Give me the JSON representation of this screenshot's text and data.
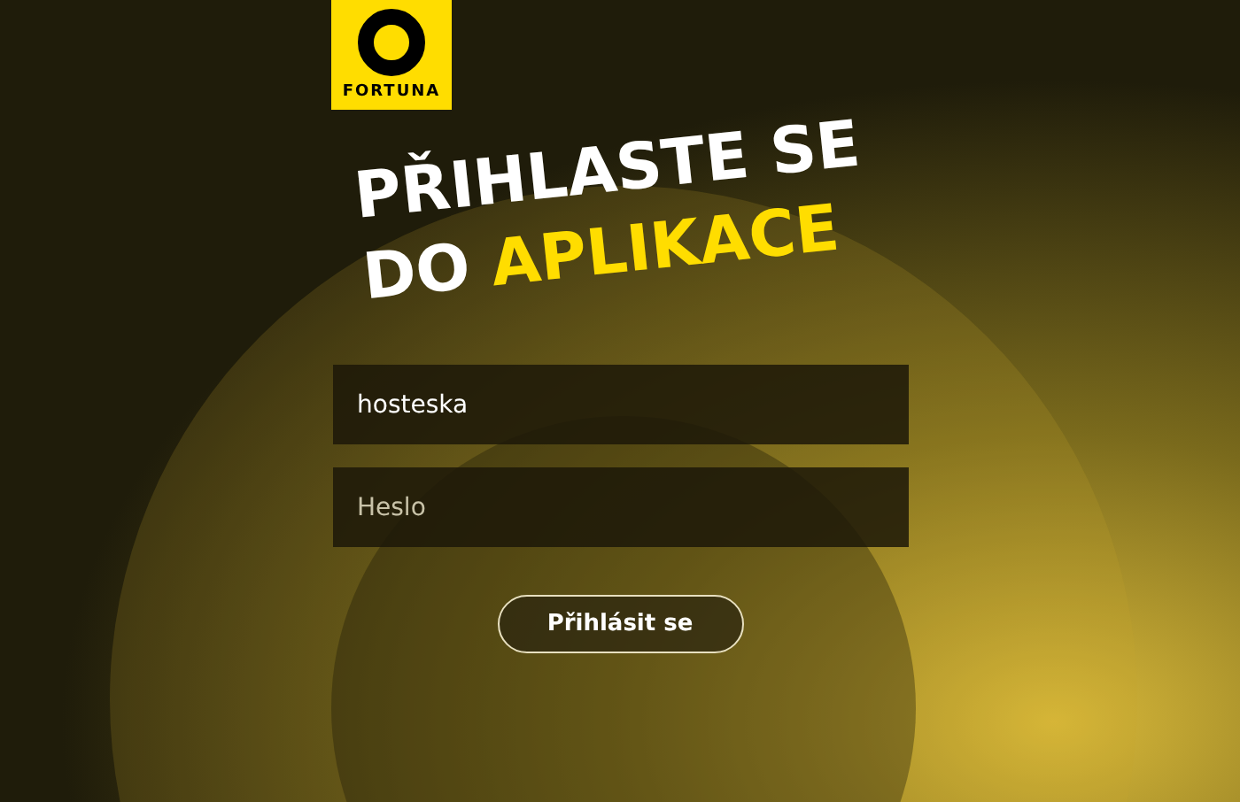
{
  "logo": {
    "text": "FORTUNA"
  },
  "heading": {
    "line_1": [
      {
        "text": "PŘIHLASTE SE",
        "highlighted": false
      }
    ],
    "line_2": [
      {
        "text": "DO",
        "highlighted": false
      },
      {
        "text": "APLIKACE",
        "highlighted": true
      }
    ]
  },
  "username_field": {
    "value": "hosteska"
  },
  "password_field": {
    "placeholder": "Heslo"
  },
  "login_button": {
    "label": "Přihlásit se"
  }
}
